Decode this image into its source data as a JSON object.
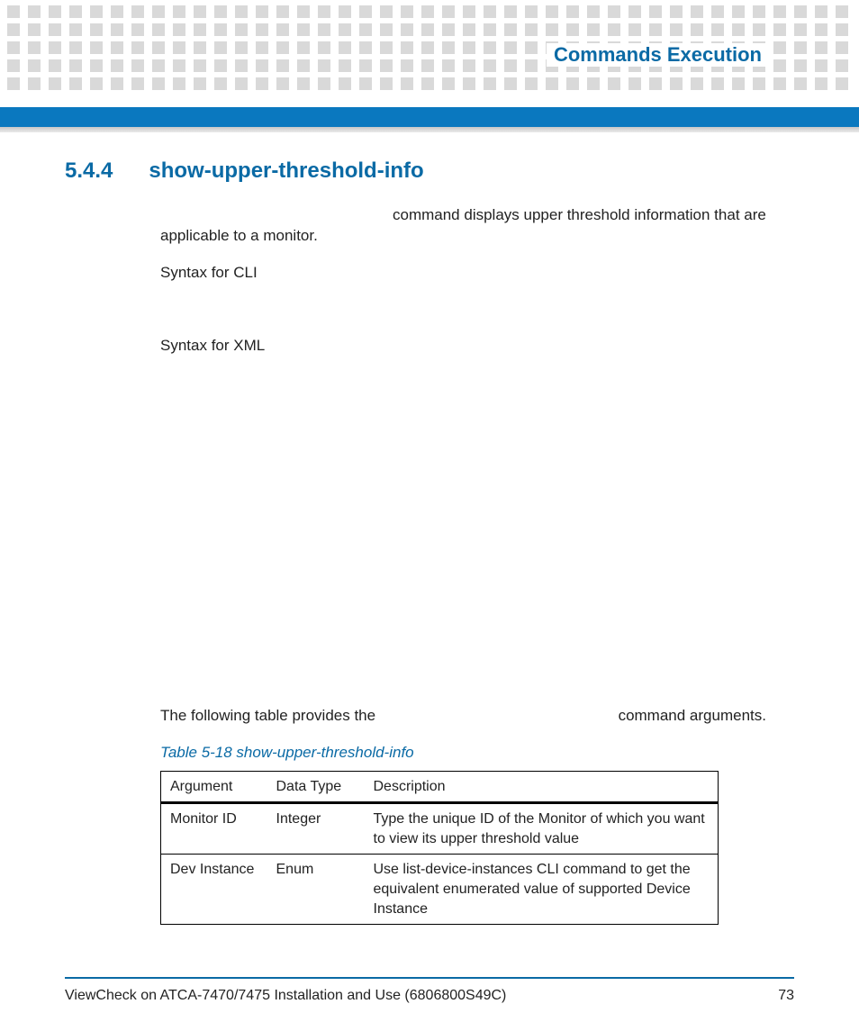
{
  "header": {
    "section_title": "Commands Execution"
  },
  "section": {
    "number": "5.4.4",
    "title": "show-upper-threshold-info",
    "intro_first": "command displays upper threshold information that are",
    "intro_rest": "applicable to a monitor.",
    "syntax_cli_label": "Syntax for CLI",
    "syntax_xml_label": "Syntax for XML",
    "args_sentence_a": "The following table provides the",
    "args_sentence_b": "command arguments."
  },
  "table": {
    "caption": "Table 5-18 show-upper-threshold-info",
    "headers": [
      "Argument",
      "Data Type",
      "Description"
    ],
    "rows": [
      {
        "argument": "Monitor ID",
        "datatype": "Integer",
        "description": "Type the unique ID of the Monitor of which you want to view its upper threshold value"
      },
      {
        "argument": "Dev Instance",
        "datatype": "Enum",
        "description": "Use list-device-instances CLI command to get the equivalent enumerated value of supported Device Instance"
      }
    ]
  },
  "footer": {
    "doc_title": "ViewCheck on ATCA-7470/7475 Installation and Use (6806800S49C)",
    "page_number": "73"
  }
}
